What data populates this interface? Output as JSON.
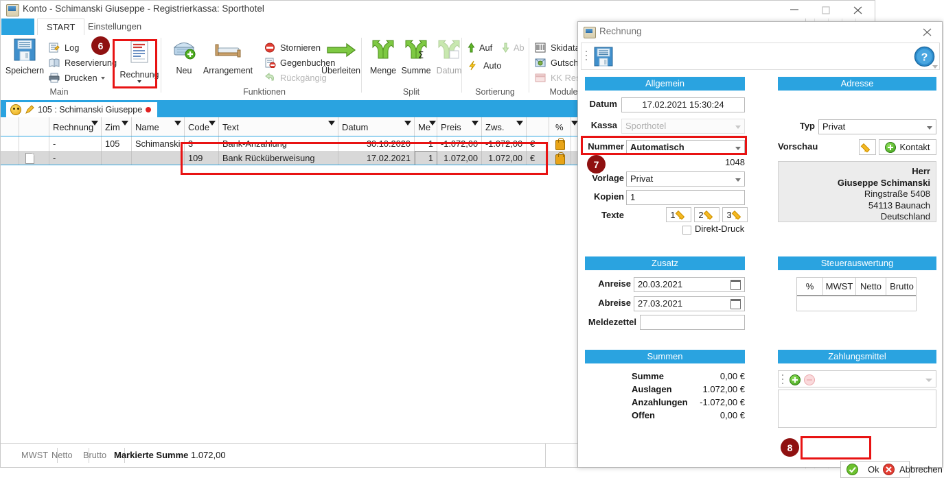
{
  "main_window": {
    "title": "Konto - Schimanski Giuseppe - Registrierkassa: Sporthotel",
    "controls": {
      "minimize": "minimize-icon",
      "maximize": "maximize-icon",
      "close": "close-icon"
    },
    "tabs": [
      {
        "label": "START",
        "active": true
      },
      {
        "label": "Einstellungen",
        "active": false
      }
    ],
    "ribbon": {
      "groups": [
        {
          "title": "Main",
          "big_buttons": [
            {
              "label": "Speichern",
              "icon": "save-icon"
            }
          ],
          "small_buttons": [
            {
              "label": "Log",
              "icon": "log-icon",
              "disabled": false
            },
            {
              "label": "Reservierung",
              "icon": "book-icon",
              "disabled": false
            },
            {
              "label": "Drucken",
              "icon": "printer-icon",
              "disabled": false,
              "has_menu": true
            }
          ]
        },
        {
          "title": "",
          "big_buttons": [
            {
              "label": "Rechnung",
              "icon": "invoice-icon",
              "has_menu": true,
              "highlighted": true
            }
          ]
        },
        {
          "title": "Funktionen",
          "big_buttons": [
            {
              "label": "Neu",
              "icon": "basket-plus-icon"
            },
            {
              "label": "Arrangement",
              "icon": "bed-icon"
            },
            {
              "label": "Überleiten",
              "icon": "arrow-right-icon"
            }
          ],
          "small_buttons": [
            {
              "label": "Stornieren",
              "icon": "cancel-icon",
              "disabled": false
            },
            {
              "label": "Gegenbuchen",
              "icon": "counter-post-icon",
              "disabled": false
            },
            {
              "label": "Rückgängig",
              "icon": "undo-icon",
              "disabled": true
            }
          ]
        },
        {
          "title": "Split",
          "big_buttons": [
            {
              "label": "Menge",
              "icon": "split-quantity-icon"
            },
            {
              "label": "Summe",
              "icon": "split-sum-icon"
            },
            {
              "label": "Datum",
              "icon": "split-date-icon",
              "disabled": true
            }
          ]
        },
        {
          "title": "Sortierung",
          "small_buttons": [
            {
              "label": "Auf",
              "icon": "arrow-up-icon",
              "disabled": false
            },
            {
              "label": "Ab",
              "icon": "arrow-down-icon",
              "disabled": true
            },
            {
              "label": "Auto",
              "icon": "lightning-icon",
              "disabled": false
            }
          ]
        },
        {
          "title": "Module",
          "small_buttons": [
            {
              "label": "Skidata",
              "icon": "barcode-icon",
              "disabled": false
            },
            {
              "label": "Gutschei",
              "icon": "voucher-icon",
              "disabled": false
            },
            {
              "label": "KK Reser",
              "icon": "creditcard-reservation-icon",
              "disabled": true
            }
          ]
        }
      ]
    },
    "person_tab": {
      "label": "105 : Schimanski Giuseppe",
      "icons": [
        "smiley-icon",
        "pencil-icon",
        "red-dot-icon"
      ]
    },
    "grid": {
      "columns": [
        "",
        "",
        "Rechnung",
        "Zim",
        "Name",
        "Code",
        "Text",
        "Datum",
        "Me",
        "Preis",
        "Zws.",
        "",
        "%",
        ""
      ],
      "rows": [
        {
          "doc": "",
          "rechnung": "-",
          "zim": "105",
          "name": "Schimanski",
          "code": "3",
          "text": "Bank-Anzahlung",
          "datum": "30.10.2020",
          "me": "1",
          "preis": "-1.072,00",
          "zws": "-1.072,00",
          "waehrung": "€",
          "locked": "lock-icon",
          "selected": false
        },
        {
          "doc": "document-icon",
          "rechnung": "-",
          "zim": "",
          "name": "",
          "code": "109",
          "text": "Bank Rücküberweisung",
          "datum": "17.02.2021",
          "me": "1",
          "preis": "1.072,00",
          "zws": "1.072,00",
          "waehrung": "€",
          "locked": "lock-icon",
          "selected": true
        }
      ]
    },
    "statusbar": {
      "cells": [
        "MWST",
        "Netto",
        "Brutto"
      ],
      "marked_label": "Markierte Summe",
      "marked_value": "1.072,00"
    }
  },
  "dialog": {
    "title": "Rechnung",
    "close_icon": "close-icon",
    "toolbar": {
      "save_icon": "save-icon",
      "help_icon": "help-icon"
    },
    "allgemein": {
      "header": "Allgemein",
      "datum_label": "Datum",
      "datum_value": "17.02.2021 15:30:24",
      "kassa_label": "Kassa",
      "kassa_value": "Sporthotel",
      "nummer_label": "Nummer",
      "nummer_value": "Automatisch",
      "nummer_counter": "1048",
      "vorlage_label": "Vorlage",
      "vorlage_value": "Privat",
      "kopien_label": "Kopien",
      "kopien_value": "1",
      "texte_label": "Texte",
      "texte_buttons": [
        "1",
        "2",
        "3"
      ],
      "direktdruck_label": "Direkt-Druck",
      "direktdruck_checked": false
    },
    "adresse": {
      "header": "Adresse",
      "typ_label": "Typ",
      "typ_value": "Privat",
      "vorschau_label": "Vorschau",
      "edit_icon": "pencil-icon",
      "kontakt_label": "Kontakt",
      "preview_lines": [
        {
          "text": "Herr",
          "bold": true
        },
        {
          "text": "Giuseppe  Schimanski",
          "bold": true
        },
        {
          "text": "Ringstraße 5408",
          "bold": false
        },
        {
          "text": "54113 Baunach",
          "bold": false
        },
        {
          "text": "Deutschland",
          "bold": false
        }
      ]
    },
    "zusatz": {
      "header": "Zusatz",
      "anreise_label": "Anreise",
      "anreise_value": "20.03.2021",
      "abreise_label": "Abreise",
      "abreise_value": "27.03.2021",
      "meldezettel_label": "Meldezettel",
      "meldezettel_value": ""
    },
    "steuerauswertung": {
      "header": "Steuerauswertung",
      "columns": [
        "%",
        "MWST",
        "Netto",
        "Brutto"
      ],
      "rows": []
    },
    "summen": {
      "header": "Summen",
      "rows": [
        {
          "label": "Summe",
          "value": "0,00 €"
        },
        {
          "label": "Auslagen",
          "value": "1.072,00 €"
        },
        {
          "label": "Anzahlungen",
          "value": "-1.072,00 €"
        },
        {
          "label": "Offen",
          "value": "0,00 €"
        }
      ]
    },
    "zahlungsmittel": {
      "header": "Zahlungsmittel",
      "add_icon": "plus-icon",
      "remove_icon": "minus-icon",
      "items": []
    },
    "footer": {
      "ok_label": "Ok",
      "ok_icon": "check-circle-icon",
      "cancel_label": "Abbrechen",
      "cancel_icon": "cancel-circle-icon"
    }
  },
  "callouts": [
    {
      "number": "6",
      "target": "rechnung-ribbon-button"
    },
    {
      "number": "7",
      "target": "nummer-combo"
    },
    {
      "number": "8",
      "target": "ok-button"
    }
  ],
  "colors": {
    "accent_blue": "#2aa3e0",
    "callout_red": "#e81313",
    "marker_dark_red": "#8f1111",
    "row_selected": "#d8d8d8"
  }
}
